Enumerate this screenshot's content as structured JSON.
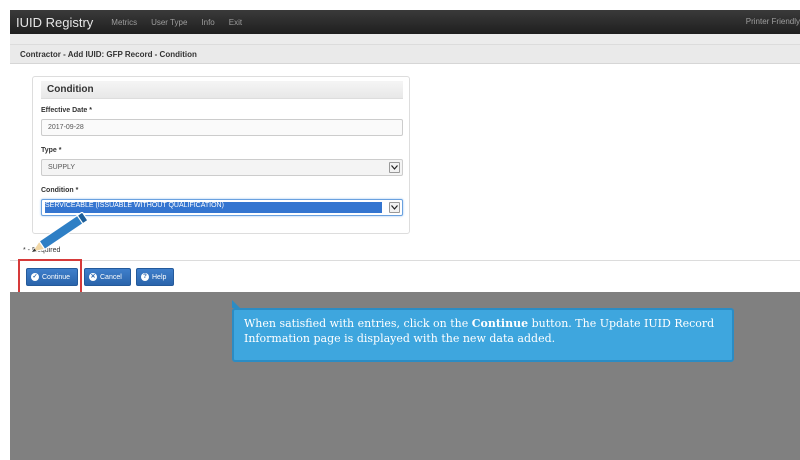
{
  "nav": {
    "brand": "IUID Registry",
    "items": [
      "Metrics",
      "User Type",
      "Info",
      "Exit"
    ],
    "right_link": "Printer Friendly"
  },
  "page": {
    "title": "Contractor - Add IUID: GFP Record - Condition"
  },
  "panel": {
    "title": "Condition",
    "effective_date": {
      "label": "Effective Date *",
      "value": "2017-09-28"
    },
    "type": {
      "label": "Type *",
      "value": "SUPPLY"
    },
    "condition": {
      "label": "Condition *",
      "value": "SERVICEABLE (ISSUABLE WITHOUT QUALIFICATION)"
    }
  },
  "required_note": "* - Required",
  "buttons": {
    "continue": "Continue",
    "cancel": "Cancel",
    "help": "Help"
  },
  "callout": {
    "text_before": "When satisfied with entries, click on the ",
    "bold": "Continue",
    "text_after": " button. The Update IUID Record Information page is displayed with the new data added."
  },
  "colors": {
    "navbar": "#222222",
    "button": "#2f6fbb",
    "selection": "#3475d0",
    "callout": "#3ea6de",
    "highlight_box": "#d63a3a",
    "overlay": "#808080"
  },
  "icons": {
    "continue": "check-circle-icon",
    "cancel": "x-circle-icon",
    "help": "question-circle-icon",
    "dropdown": "chevron-down-icon",
    "pointer": "pencil-pointer-icon"
  }
}
